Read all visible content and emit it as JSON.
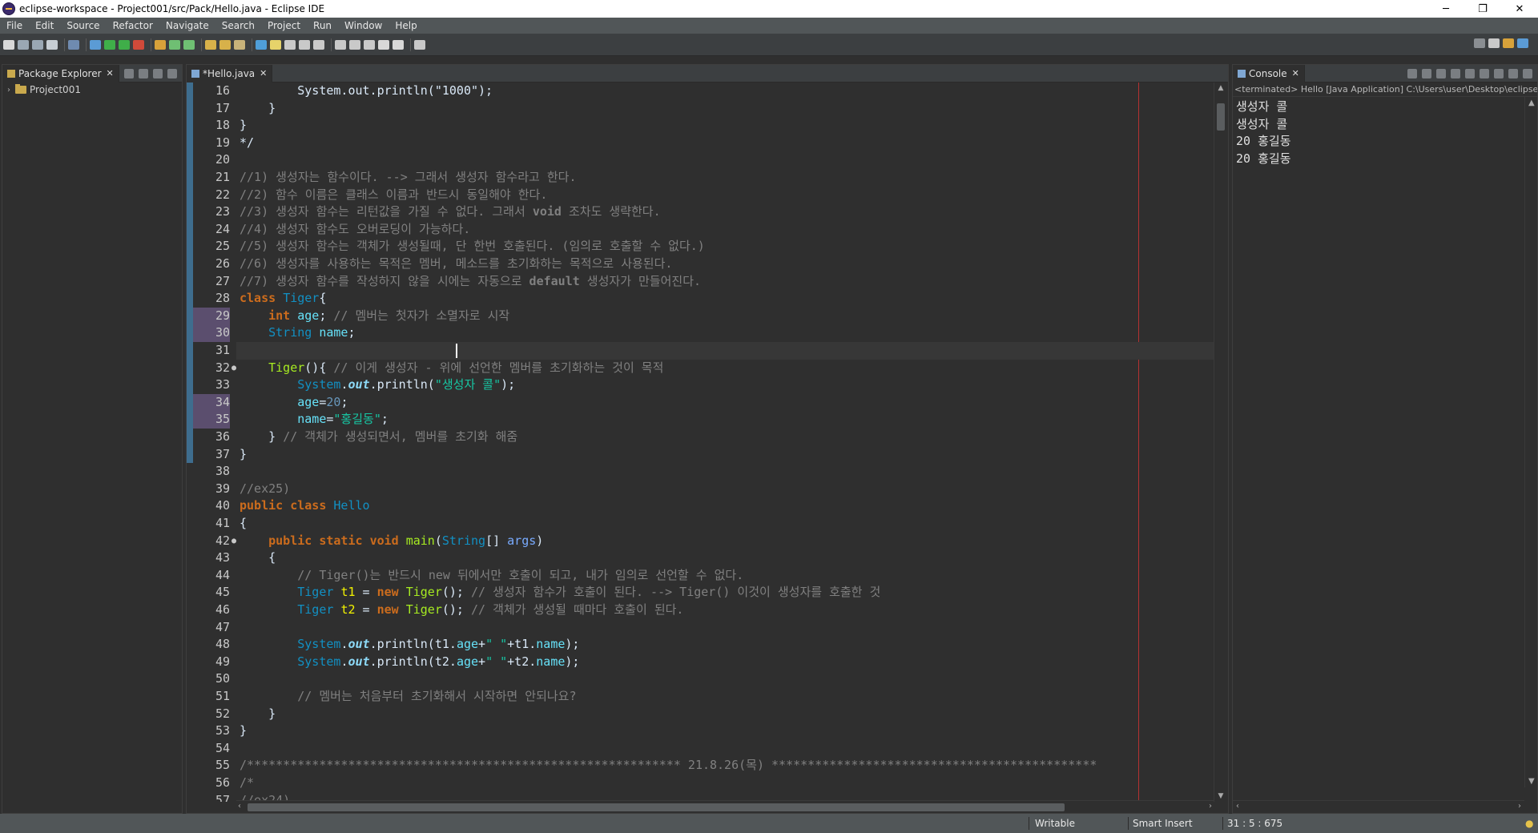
{
  "window": {
    "title": "eclipse-workspace - Project001/src/Pack/Hello.java - Eclipse IDE",
    "minimize": "─",
    "restore": "❐",
    "close": "✕"
  },
  "menu": [
    "File",
    "Edit",
    "Source",
    "Refactor",
    "Navigate",
    "Search",
    "Project",
    "Run",
    "Window",
    "Help"
  ],
  "package_explorer": {
    "tab_label": "Package Explorer",
    "close": "✕",
    "project": "Project001"
  },
  "editor": {
    "tab_label": "*Hello.java",
    "close": "✕",
    "lines": [
      {
        "n": "16",
        "tokens": [
          [
            "def",
            "        System.out.println(\"1000\");"
          ]
        ]
      },
      {
        "n": "17",
        "tokens": [
          [
            "def",
            "    }"
          ]
        ]
      },
      {
        "n": "18",
        "tokens": [
          [
            "def",
            "}"
          ]
        ]
      },
      {
        "n": "19",
        "tokens": [
          [
            "def",
            "*/"
          ]
        ]
      },
      {
        "n": "20",
        "tokens": []
      },
      {
        "n": "21",
        "tokens": [
          [
            "cmt",
            "//1) 생성자는 함수이다. --> 그래서 생성자 함수라고 한다."
          ]
        ]
      },
      {
        "n": "22",
        "tokens": [
          [
            "cmt",
            "//2) 함수 이름은 클래스 이름과 반드시 동일해야 한다."
          ]
        ]
      },
      {
        "n": "23",
        "tokens": [
          [
            "cmt",
            "//3) 생성자 함수는 리턴값을 가질 수 없다. 그래서 "
          ],
          [
            "cmtb",
            "void"
          ],
          [
            "cmt",
            " 조차도 생략한다."
          ]
        ]
      },
      {
        "n": "24",
        "tokens": [
          [
            "cmt",
            "//4) 생성자 함수도 오버로딩이 가능하다."
          ]
        ]
      },
      {
        "n": "25",
        "tokens": [
          [
            "cmt",
            "//5) 생성자 함수는 객체가 생성될때, 단 한번 호출된다. (임의로 호출할 수 없다.)"
          ]
        ]
      },
      {
        "n": "26",
        "tokens": [
          [
            "cmt",
            "//6) 생성자를 사용하는 목적은 멤버, 메소드를 초기화하는 목적으로 사용된다."
          ]
        ]
      },
      {
        "n": "27",
        "tokens": [
          [
            "cmt",
            "//7) 생성자 함수를 작성하지 않을 시에는 자동으로 "
          ],
          [
            "cmtb",
            "default"
          ],
          [
            "cmt",
            " 생성자가 만들어진다."
          ]
        ]
      },
      {
        "n": "28",
        "tokens": [
          [
            "kw",
            "class"
          ],
          [
            "def",
            " "
          ],
          [
            "type",
            "Tiger"
          ],
          [
            "def",
            "{"
          ]
        ]
      },
      {
        "n": "29",
        "occ": true,
        "tokens": [
          [
            "def",
            "    "
          ],
          [
            "kw",
            "int"
          ],
          [
            "def",
            " "
          ],
          [
            "fld",
            "age"
          ],
          [
            "def",
            "; "
          ],
          [
            "cmt",
            "// 멤버는 첫자가 소멸자로 시작"
          ]
        ]
      },
      {
        "n": "30",
        "occ": true,
        "tokens": [
          [
            "def",
            "    "
          ],
          [
            "type",
            "String"
          ],
          [
            "def",
            " "
          ],
          [
            "fld",
            "name"
          ],
          [
            "def",
            ";"
          ]
        ]
      },
      {
        "n": "31",
        "current": true,
        "tokens": []
      },
      {
        "n": "32",
        "fold": true,
        "tokens": [
          [
            "def",
            "    "
          ],
          [
            "mth",
            "Tiger"
          ],
          [
            "def",
            "(){ "
          ],
          [
            "cmt",
            "// 이게 생성자 - 위에 선언한 멤버를 초기화하는 것이 목적"
          ]
        ]
      },
      {
        "n": "33",
        "tokens": [
          [
            "def",
            "        "
          ],
          [
            "type",
            "System"
          ],
          [
            "def",
            "."
          ],
          [
            "it",
            "out"
          ],
          [
            "def",
            ".println("
          ],
          [
            "str",
            "\"생성자 콜\""
          ],
          [
            "def",
            ");"
          ]
        ]
      },
      {
        "n": "34",
        "occ": true,
        "tokens": [
          [
            "def",
            "        "
          ],
          [
            "fld",
            "age"
          ],
          [
            "def",
            "="
          ],
          [
            "num",
            "20"
          ],
          [
            "def",
            ";"
          ]
        ]
      },
      {
        "n": "35",
        "occ": true,
        "tokens": [
          [
            "def",
            "        "
          ],
          [
            "fld",
            "name"
          ],
          [
            "def",
            "="
          ],
          [
            "str",
            "\"홍길동\""
          ],
          [
            "def",
            ";"
          ]
        ]
      },
      {
        "n": "36",
        "tokens": [
          [
            "def",
            "    } "
          ],
          [
            "cmt",
            "// 객체가 생성되면서, 멤버를 초기화 해줌"
          ]
        ]
      },
      {
        "n": "37",
        "tokens": [
          [
            "def",
            "}"
          ]
        ]
      },
      {
        "n": "38",
        "tokens": []
      },
      {
        "n": "39",
        "tokens": [
          [
            "cmt",
            "//ex25)"
          ]
        ]
      },
      {
        "n": "40",
        "tokens": [
          [
            "kw",
            "public"
          ],
          [
            "def",
            " "
          ],
          [
            "kw",
            "class"
          ],
          [
            "def",
            " "
          ],
          [
            "type",
            "Hello"
          ]
        ]
      },
      {
        "n": "41",
        "tokens": [
          [
            "def",
            "{"
          ]
        ]
      },
      {
        "n": "42",
        "fold": true,
        "tokens": [
          [
            "def",
            "    "
          ],
          [
            "kw",
            "public"
          ],
          [
            "def",
            " "
          ],
          [
            "kw",
            "static"
          ],
          [
            "def",
            " "
          ],
          [
            "kw",
            "void"
          ],
          [
            "def",
            " "
          ],
          [
            "mth",
            "main"
          ],
          [
            "def",
            "("
          ],
          [
            "type",
            "String"
          ],
          [
            "def",
            "[] "
          ],
          [
            "param",
            "args"
          ],
          [
            "def",
            ")"
          ]
        ]
      },
      {
        "n": "43",
        "tokens": [
          [
            "def",
            "    {"
          ]
        ]
      },
      {
        "n": "44",
        "tokens": [
          [
            "def",
            "        "
          ],
          [
            "cmt",
            "// Tiger()는 반드시 new 뒤에서만 호출이 되고, 내가 임의로 선언할 수 없다."
          ]
        ]
      },
      {
        "n": "45",
        "tokens": [
          [
            "def",
            "        "
          ],
          [
            "type",
            "Tiger"
          ],
          [
            "def",
            " "
          ],
          [
            "var",
            "t1"
          ],
          [
            "def",
            " = "
          ],
          [
            "kw",
            "new"
          ],
          [
            "def",
            " "
          ],
          [
            "mth",
            "Tiger"
          ],
          [
            "def",
            "(); "
          ],
          [
            "cmt",
            "// 생성자 함수가 호출이 된다. --> Tiger() 이것이 생성자를 호출한 것"
          ]
        ]
      },
      {
        "n": "46",
        "tokens": [
          [
            "def",
            "        "
          ],
          [
            "type",
            "Tiger"
          ],
          [
            "def",
            " "
          ],
          [
            "var",
            "t2"
          ],
          [
            "def",
            " = "
          ],
          [
            "kw",
            "new"
          ],
          [
            "def",
            " "
          ],
          [
            "mth",
            "Tiger"
          ],
          [
            "def",
            "(); "
          ],
          [
            "cmt",
            "// 객체가 생성될 때마다 호출이 된다."
          ]
        ]
      },
      {
        "n": "47",
        "tokens": []
      },
      {
        "n": "48",
        "tokens": [
          [
            "def",
            "        "
          ],
          [
            "type",
            "System"
          ],
          [
            "def",
            "."
          ],
          [
            "it",
            "out"
          ],
          [
            "def",
            ".println(t1."
          ],
          [
            "fld",
            "age"
          ],
          [
            "def",
            "+"
          ],
          [
            "str",
            "\" \""
          ],
          [
            "def",
            "+t1."
          ],
          [
            "fld",
            "name"
          ],
          [
            "def",
            ");"
          ]
        ]
      },
      {
        "n": "49",
        "tokens": [
          [
            "def",
            "        "
          ],
          [
            "type",
            "System"
          ],
          [
            "def",
            "."
          ],
          [
            "it",
            "out"
          ],
          [
            "def",
            ".println(t2."
          ],
          [
            "fld",
            "age"
          ],
          [
            "def",
            "+"
          ],
          [
            "str",
            "\" \""
          ],
          [
            "def",
            "+t2."
          ],
          [
            "fld",
            "name"
          ],
          [
            "def",
            ");"
          ]
        ]
      },
      {
        "n": "50",
        "tokens": []
      },
      {
        "n": "51",
        "tokens": [
          [
            "def",
            "        "
          ],
          [
            "cmt",
            "// 멤버는 처음부터 초기화해서 시작하면 안되나요?"
          ]
        ]
      },
      {
        "n": "52",
        "tokens": [
          [
            "def",
            "    }"
          ]
        ]
      },
      {
        "n": "53",
        "tokens": [
          [
            "def",
            "}"
          ]
        ]
      },
      {
        "n": "54",
        "tokens": []
      },
      {
        "n": "55",
        "tokens": [
          [
            "cmt",
            "/************************************************************ 21.8.26(목) *********************************************"
          ]
        ]
      },
      {
        "n": "56",
        "tokens": [
          [
            "cmt",
            "/*"
          ]
        ]
      },
      {
        "n": "57",
        "tokens": [
          [
            "cmt",
            "//ex24)"
          ]
        ]
      }
    ]
  },
  "console": {
    "tab_label": "Console",
    "close": "✕",
    "description": "<terminated> Hello [Java Application] C:\\Users\\user\\Desktop\\eclipse\\plugins",
    "output": [
      "생성자 콜",
      "생성자 콜",
      "20 홍길동",
      "20 홍길동"
    ]
  },
  "status": {
    "writable": "Writable",
    "insert_mode": "Smart Insert",
    "position": "31 : 5 : 675"
  },
  "colors": {
    "keyword": "#cc6c1d",
    "type": "#1290c3",
    "field": "#66e1f8",
    "string": "#17c6a3",
    "comment": "#808080",
    "method": "#a7ec21",
    "local_var": "#f2f200",
    "param": "#79abff",
    "number": "#6897bb",
    "print_margin": "#b43232",
    "occurrence": "#5b4e6e"
  }
}
